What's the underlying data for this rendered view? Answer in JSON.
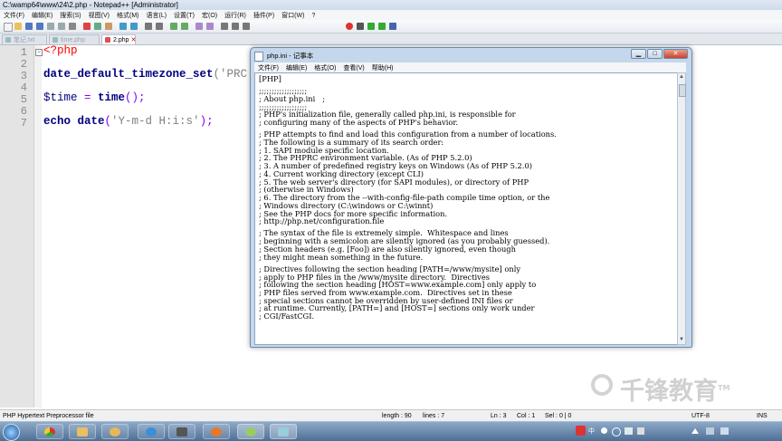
{
  "npp": {
    "title": "C:\\wamp64\\www\\24\\2.php - Notepad++ [Administrator]",
    "menu": [
      "文件(F)",
      "编辑(E)",
      "搜索(S)",
      "视图(V)",
      "格式(M)",
      "语言(L)",
      "设置(T)",
      "宏(O)",
      "运行(R)",
      "插件(P)",
      "窗口(W)",
      "?"
    ],
    "tabs": [
      {
        "label": "笔记.txt",
        "active": false
      },
      {
        "label": "time.php",
        "active": false
      },
      {
        "label": "2.php",
        "active": true
      }
    ],
    "tab_close": "✕"
  },
  "editor": {
    "line_numbers": [
      "1",
      "2",
      "3",
      "4",
      "5",
      "6",
      "7"
    ],
    "lines": {
      "l1_tag": "<?php",
      "l3_fn": "date_default_timezone_set",
      "l3_rest": "('PRC');",
      "l5_var": "$time",
      "l5_eq": " = ",
      "l5_fn": "time",
      "l5_rest": "();",
      "l7_kw": "echo",
      "l7_fn": " date",
      "l7_p1": "(",
      "l7_str": "'Y-m-d H:i:s'",
      "l7_p2": ");"
    }
  },
  "notepad": {
    "title": "php.ini - 记事本",
    "menu": [
      "文件(F)",
      "编辑(E)",
      "格式(O)",
      "查看(V)",
      "帮助(H)"
    ],
    "controls": {
      "minimize": "▁",
      "maximize": "□",
      "close": "✕"
    },
    "text_lines": [
      "[PHP]",
      "",
      ";;;;;;;;;;;;;;;;;;;",
      "; About php.ini   ;",
      ";;;;;;;;;;;;;;;;;;;",
      "; PHP's initialization file, generally called php.ini, is responsible for",
      "; configuring many of the aspects of PHP's behavior.",
      "",
      "; PHP attempts to find and load this configuration from a number of locations.",
      "; The following is a summary of its search order:",
      "; 1. SAPI module specific location.",
      "; 2. The PHPRC environment variable. (As of PHP 5.2.0)",
      "; 3. A number of predefined registry keys on Windows (As of PHP 5.2.0)",
      "; 4. Current working directory (except CLI)",
      "; 5. The web server's directory (for SAPI modules), or directory of PHP",
      "; (otherwise in Windows)",
      "; 6. The directory from the --with-config-file-path compile time option, or the",
      "; Windows directory (C:\\windows or C:\\winnt)",
      "; See the PHP docs for more specific information.",
      "; http://php.net/configuration.file",
      "",
      "; The syntax of the file is extremely simple.  Whitespace and lines",
      "; beginning with a semicolon are silently ignored (as you probably guessed).",
      "; Section headers (e.g. [Foo]) are also silently ignored, even though",
      "; they might mean something in the future.",
      "",
      "; Directives following the section heading [PATH=/www/mysite] only",
      "; apply to PHP files in the /www/mysite directory.  Directives",
      "; following the section heading [HOST=www.example.com] only apply to",
      "; PHP files served from www.example.com.  Directives set in these",
      "; special sections cannot be overridden by user-defined INI files or",
      "; at runtime. Currently, [PATH=] and [HOST=] sections only work under",
      "; CGI/FastCGI."
    ]
  },
  "status": {
    "language": "PHP Hypertext Preprocessor file",
    "length": "length : 90",
    "lines": "lines : 7",
    "ln": "Ln : 3",
    "col": "Col : 1",
    "sel": "Sel : 0 | 0",
    "encoding": "UTF-8",
    "mode": "INS"
  },
  "taskbar": {
    "apps": [
      "chrome-icon",
      "folder-icon",
      "users-icon",
      "ie-icon",
      "sublime-icon",
      "firefox-icon",
      "notepadpp-icon",
      "notepad-icon"
    ],
    "tray_time": "",
    "ime": "中"
  },
  "watermark": {
    "text": "千锋教育",
    "tm": "TM"
  },
  "colors": {
    "php_tag": "#ff0000",
    "function": "#000080",
    "string": "#808080",
    "active_tab_icon": "#e05050"
  }
}
